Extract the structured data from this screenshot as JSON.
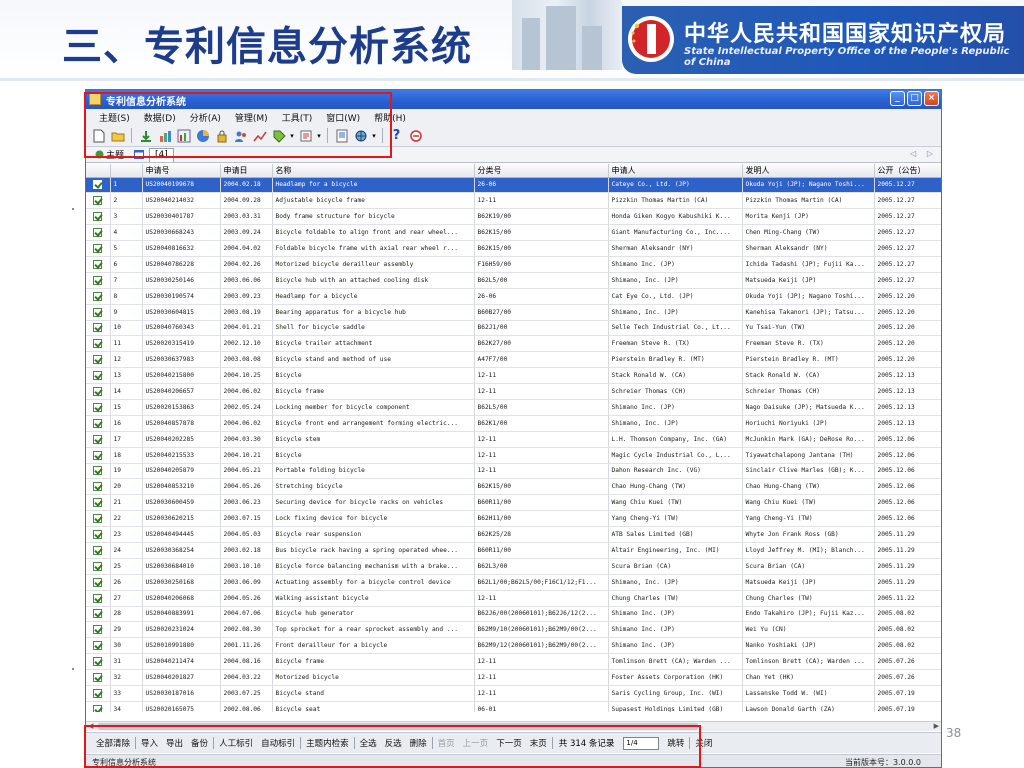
{
  "slide": {
    "title": "三、专利信息分析系统",
    "agency_cn": "中华人民共和国国家知识产权局",
    "agency_en": "State Intellectual Property Office of the People's Republic of China",
    "page_number": "38"
  },
  "window": {
    "title": "专利信息分析系统",
    "controls": {
      "minimize": "_",
      "maximize": "□",
      "close": "×"
    }
  },
  "menu": [
    "主题(S)",
    "数据(D)",
    "分析(A)",
    "管理(M)",
    "工具(T)",
    "窗口(W)",
    "帮助(H)"
  ],
  "tabs": [
    {
      "label": "主题",
      "active": false
    },
    {
      "label": "[4]",
      "active": true
    }
  ],
  "tab_nav": "◁ ▷",
  "grid": {
    "columns": [
      "",
      "",
      "申请号",
      "申请日",
      "名称",
      "分类号",
      "申请人",
      "发明人",
      "公开（公告）"
    ],
    "rows": [
      [
        "1",
        "US20040199678",
        "2004.02.18",
        "Headlamp for a bicycle",
        "26-06",
        "Cateye Co., Ltd. (JP)",
        "Okuda Yoji (JP); Nagano Toshi...",
        "2005.12.27"
      ],
      [
        "2",
        "US20040214032",
        "2004.09.28",
        "Adjustable bicycle frame",
        "12-11",
        "Pizzkin Thomas Martin (CA)",
        "Pizzkin Thomas Martin (CA)",
        "2005.12.27"
      ],
      [
        "3",
        "US20030401787",
        "2003.03.31",
        "Body frame structure for bicycle",
        "B62K19/00",
        "Honda Giken Kogyo Kabushiki K...",
        "Morita Kenji (JP)",
        "2005.12.27"
      ],
      [
        "4",
        "US20030668243",
        "2003.09.24",
        "Bicycle foldable to align front and rear wheel...",
        "B62K15/00",
        "Giant Manufacturing Co., Inc....",
        "Chen Ming-Chang (TW)",
        "2005.12.27"
      ],
      [
        "5",
        "US20040816632",
        "2004.04.02",
        "Foldable bicycle frame with axial rear wheel r...",
        "B62K15/00",
        "Sherman Aleksandr (NY)",
        "Sherman Aleksandr (NY)",
        "2005.12.27"
      ],
      [
        "6",
        "US20040786228",
        "2004.02.26",
        "Motorized bicycle derailleur assembly",
        "F16H59/00",
        "Shimano Inc. (JP)",
        "Ichida Tadashi (JP); Fujii Ka...",
        "2005.12.27"
      ],
      [
        "7",
        "US20030250146",
        "2003.06.06",
        "Bicycle hub with an attached cooling disk",
        "B62L5/00",
        "Shimano, Inc. (JP)",
        "Matsueda Keiji (JP)",
        "2005.12.27"
      ],
      [
        "8",
        "US20030190574",
        "2003.09.23",
        "Headlamp for a bicycle",
        "26-06",
        "Cat Eye Co., Ltd. (JP)",
        "Okuda Yoji (JP); Nagano Toshi...",
        "2005.12.20"
      ],
      [
        "9",
        "US20030604815",
        "2003.08.19",
        "Bearing apparatus for a bicycle hub",
        "B60B27/00",
        "Shimano, Inc. (JP)",
        "Kanehisa Takanori (JP); Tatsu...",
        "2005.12.20"
      ],
      [
        "10",
        "US20040760343",
        "2004.01.21",
        "Shell for bicycle saddle",
        "B62J1/00",
        "Selle Tech Industrial Co., Lt...",
        "Yu Tsai-Yun (TW)",
        "2005.12.20"
      ],
      [
        "11",
        "US20020315419",
        "2002.12.10",
        "Bicycle trailer attachment",
        "B62K27/00",
        "Freeman Steve R. (TX)",
        "Freeman Steve R. (TX)",
        "2005.12.20"
      ],
      [
        "12",
        "US20030637983",
        "2003.08.08",
        "Bicycle stand and method of use",
        "A47F7/00",
        "Pierstein Bradley R. (MT)",
        "Pierstein Bradley R. (MT)",
        "2005.12.20"
      ],
      [
        "13",
        "US20040215800",
        "2004.10.25",
        "Bicycle",
        "12-11",
        "Stack Ronald W. (CA)",
        "Stack Ronald W. (CA)",
        "2005.12.13"
      ],
      [
        "14",
        "US20040206657",
        "2004.06.02",
        "Bicycle frame",
        "12-11",
        "Schreier Thomas (CH)",
        "Schreier Thomas (CH)",
        "2005.12.13"
      ],
      [
        "15",
        "US20020153863",
        "2002.05.24",
        "Locking member for bicycle component",
        "B62L5/00",
        "Shimano Inc. (JP)",
        "Nago Daisuke (JP); Matsueda K...",
        "2005.12.13"
      ],
      [
        "16",
        "US20040857878",
        "2004.06.02",
        "Bicycle front end arrangement forming electric...",
        "B62K1/00",
        "Shimano, Inc. (JP)",
        "Horiuchi Noriyuki (JP)",
        "2005.12.13"
      ],
      [
        "17",
        "US20040202285",
        "2004.03.30",
        "Bicycle stem",
        "12-11",
        "L.H. Thomson Company, Inc. (GA)",
        "McJunkin Mark (GA); DeRose Ro...",
        "2005.12.06"
      ],
      [
        "18",
        "US20040215533",
        "2004.10.21",
        "Bicycle",
        "12-11",
        "Magic Cycle Industrial Co., L...",
        "Tiyawatchalapong Jantana (TH)",
        "2005.12.06"
      ],
      [
        "19",
        "US20040205879",
        "2004.05.21",
        "Portable folding bicycle",
        "12-11",
        "Dahon Research Inc. (VG)",
        "Sinclair Clive Marles (GB); K...",
        "2005.12.06"
      ],
      [
        "20",
        "US20040853210",
        "2004.05.26",
        "Stretching bicycle",
        "B62K15/00",
        "Chao Hung-Chang (TW)",
        "Chao Hung-Chang (TW)",
        "2005.12.06"
      ],
      [
        "21",
        "US20030600459",
        "2003.06.23",
        "Securing device for bicycle racks on vehicles",
        "B60R11/00",
        "Wang Chiu Kuei (TW)",
        "Wang Chiu Kuei (TW)",
        "2005.12.06"
      ],
      [
        "22",
        "US20030620215",
        "2003.07.15",
        "Lock fixing device for bicycle",
        "B62H11/00",
        "Yang Cheng-Yi (TW)",
        "Yang Cheng-Yi (TW)",
        "2005.12.06"
      ],
      [
        "23",
        "US20040494445",
        "2004.05.03",
        "Bicycle rear suspension",
        "B62K25/28",
        "ATB Sales Limited (GB)",
        "Whyte Jon Frank Ross (GB)",
        "2005.11.29"
      ],
      [
        "24",
        "US20030368254",
        "2003.02.18",
        "Bus bicycle rack having a spring operated whee...",
        "B60R11/00",
        "Altair Engineering, Inc. (MI)",
        "Lloyd Jeffrey M. (MI); Blanch...",
        "2005.11.29"
      ],
      [
        "25",
        "US20030684010",
        "2003.10.10",
        "Bicycle force balancing mechanism with a brake...",
        "B62L3/00",
        "Scura Brian (CA)",
        "Scura Brian (CA)",
        "2005.11.29"
      ],
      [
        "26",
        "US20030250168",
        "2003.06.09",
        "Actuating assembly for a bicycle control device",
        "B62L1/00;B62L5/00;F16C1/12;F1...",
        "Shimano, Inc. (JP)",
        "Matsueda Keiji (JP)",
        "2005.11.29"
      ],
      [
        "27",
        "US20040206068",
        "2004.05.26",
        "Walking assistant bicycle",
        "12-11",
        "Chung Charles (TW)",
        "Chung Charles (TW)",
        "2005.11.22"
      ],
      [
        "28",
        "US20040883991",
        "2004.07.06",
        "Bicycle hub generator",
        "B62J6/00(20060101);B62J6/12(2...",
        "Shimano Inc. (JP)",
        "Endo Takahiro (JP); Fujii Kaz...",
        "2005.08.02"
      ],
      [
        "29",
        "US20020231024",
        "2002.08.30",
        "Top sprocket for a rear sprocket assembly and ...",
        "B62M9/10(20060101);B62M9/00(2...",
        "Shimano Inc. (JP)",
        "Wei Yu (CN)",
        "2005.08.02"
      ],
      [
        "30",
        "US20010991880",
        "2001.11.26",
        "Front derailleur for a bicycle",
        "B62M9/12(20060101);B62M9/00(2...",
        "Shimano Inc. (JP)",
        "Nanko Yoshiaki (JP)",
        "2005.08.02"
      ],
      [
        "31",
        "US20040211474",
        "2004.08.16",
        "Bicycle frame",
        "12-11",
        "Tomlinson Brett (CA); Warden ...",
        "Tomlinson Brett (CA); Warden ...",
        "2005.07.26"
      ],
      [
        "32",
        "US20040201827",
        "2004.03.22",
        "Motorized bicycle",
        "12-11",
        "Foster Assets Corporation (HK)",
        "Chan Yet (HK)",
        "2005.07.26"
      ],
      [
        "33",
        "US20030187016",
        "2003.07.25",
        "Bicycle stand",
        "12-11",
        "Saris Cycling Group, Inc. (WI)",
        "Lassanske Todd W. (WI)",
        "2005.07.19"
      ],
      [
        "34",
        "US20020165075",
        "2002.08.06",
        "Bicycle seat",
        "06-01",
        "Supasest Holdings Limited (GB)",
        "Lawson Donald Garth (ZA)",
        "2005.07.19"
      ],
      [
        "35",
        "US20030601421",
        "2003.06.23",
        "Exercise bicycle virtual reality steering appa...",
        "A63B69/16(20060101)",
        "Nusbaum Neil M. (CA)",
        "Nusbaum Neil M. (CA)",
        "2005.07.19"
      ]
    ]
  },
  "bottom_bar": {
    "buttons": [
      "全部清除",
      "导入",
      "导出",
      "备份",
      "人工标引",
      "自动标引",
      "主题内检索",
      "全选",
      "反选",
      "删除"
    ],
    "nav_disabled": [
      "首页",
      "上一页"
    ],
    "nav_enabled": [
      "下一页",
      "末页"
    ],
    "record_prefix": "共",
    "record_count": "314",
    "record_suffix": "条记录",
    "page_value": "1/4",
    "jump_label": "跳转",
    "close_label": "关闭"
  },
  "statusbar": {
    "left": "专利信息分析系统",
    "right": "当前版本号：3.0.0.0"
  },
  "colors": {
    "highlight": "#e01818",
    "selection": "#2f62c9",
    "title_blue": "#1d3c8c",
    "banner_blue": "#1e58b8"
  }
}
